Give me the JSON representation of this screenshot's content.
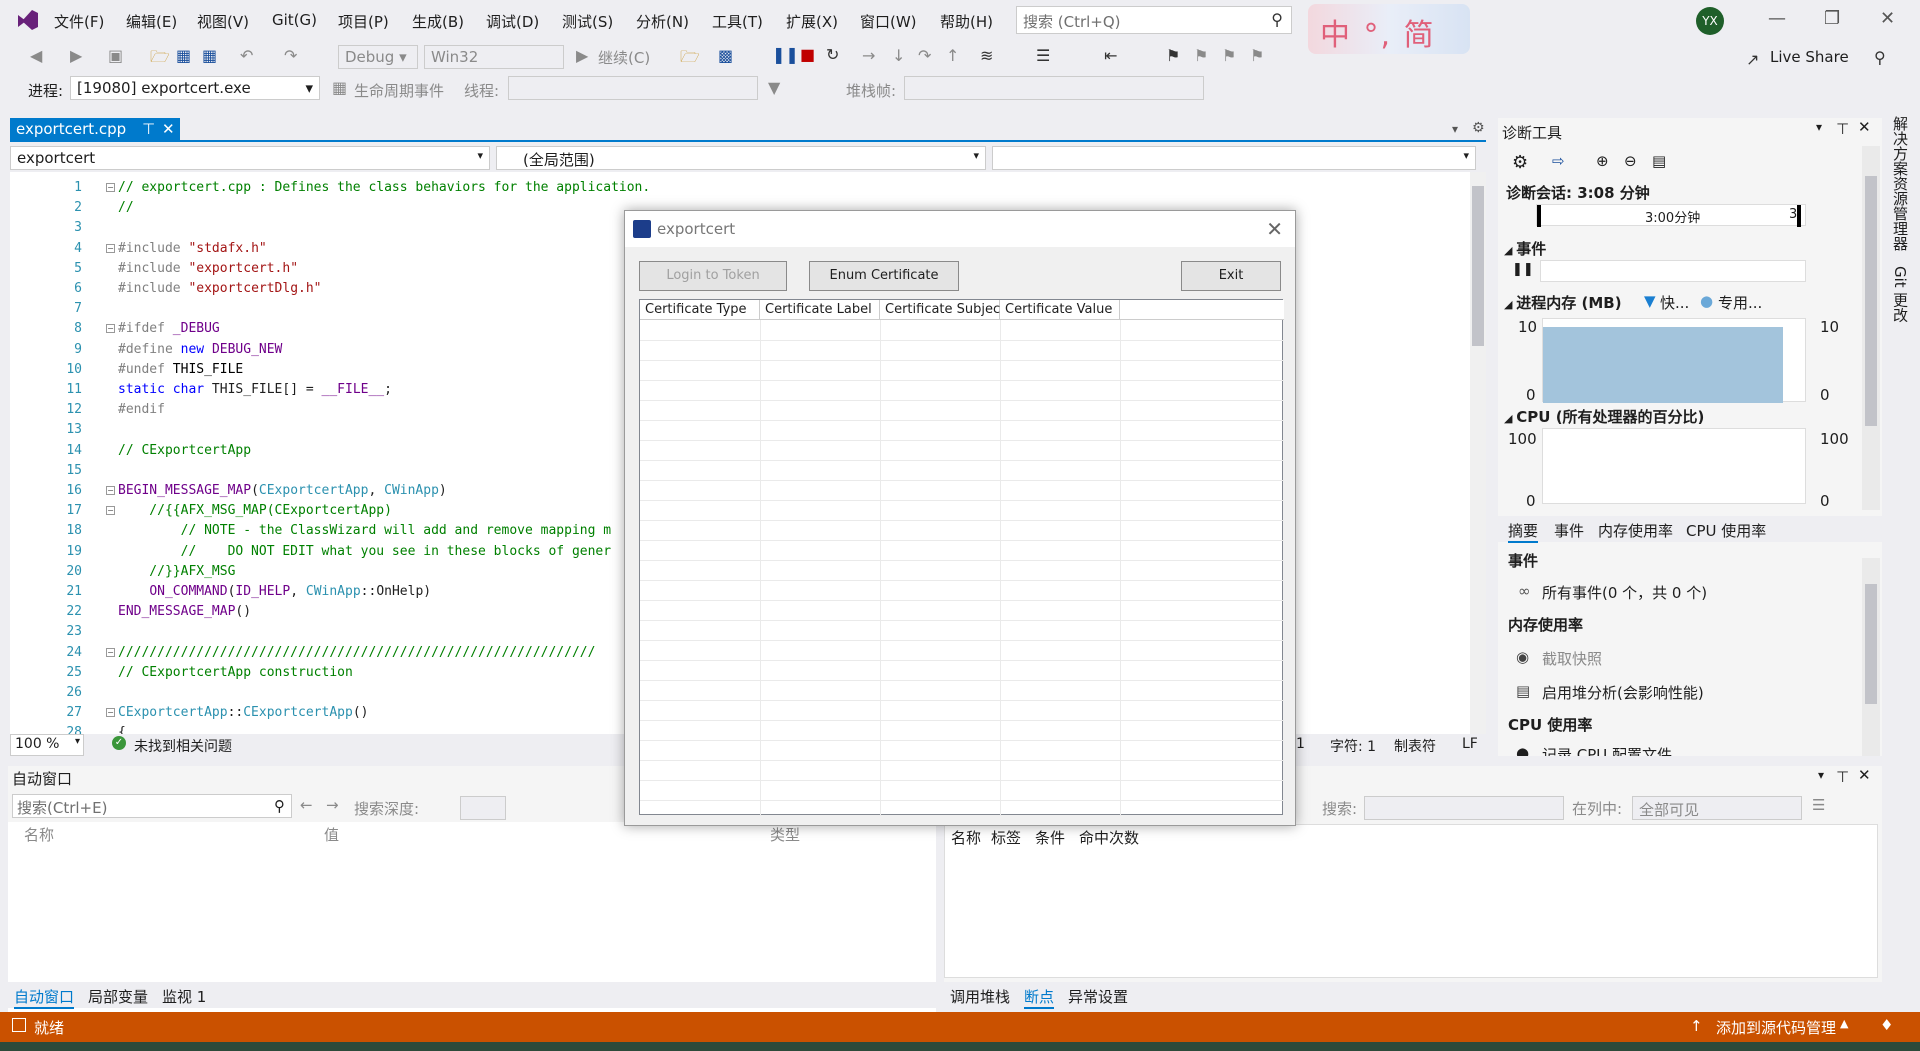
{
  "menu": [
    "文件(F)",
    "编辑(E)",
    "视图(V)",
    "Git(G)",
    "项目(P)",
    "生成(B)",
    "调试(D)",
    "测试(S)",
    "分析(N)",
    "工具(T)",
    "扩展(X)",
    "窗口(W)",
    "帮助(H)"
  ],
  "search": {
    "placeholder": "搜索 (Ctrl+Q)"
  },
  "ime": "中 °, 简",
  "avatar": "YX",
  "toolbar": {
    "config": "Debug",
    "platform": "Win32",
    "continue": "继续(C)",
    "live_share": "Live Share"
  },
  "toolbar2": {
    "process_label": "进程:",
    "process_value": "[19080] exportcert.exe",
    "lifecycle": "生命周期事件",
    "thread_label": "线程:",
    "stack_label": "堆栈帧:"
  },
  "editor": {
    "tab": "exportcert.cpp",
    "nav_left": "exportcert",
    "nav_mid": "(全局范围)",
    "zoom": "100 %",
    "issues": "未找到相关问题",
    "status_ln": "1",
    "status_ch": "字符: 1",
    "status_tab": "制表符",
    "status_lf": "LF",
    "line_numbers": [
      "1",
      "2",
      "3",
      "4",
      "5",
      "6",
      "7",
      "8",
      "9",
      "10",
      "11",
      "12",
      "13",
      "14",
      "15",
      "16",
      "17",
      "18",
      "19",
      "20",
      "21",
      "22",
      "23",
      "24",
      "25",
      "26",
      "27",
      "28"
    ]
  },
  "diag": {
    "title": "诊断工具",
    "session": "诊断会话: 3:08 分钟",
    "timeline": "3:00分钟",
    "timeline_end": "3",
    "events": "事件",
    "memory": "进程内存 (MB)",
    "mem_legend1": "快...",
    "mem_legend2": "专用...",
    "mem_max": "10",
    "mem_min": "0",
    "cpu": "CPU (所有处理器的百分比)",
    "cpu_max": "100",
    "cpu_min": "0",
    "tabs": [
      "摘要",
      "事件",
      "内存使用率",
      "CPU 使用率"
    ],
    "sec_events": "事件",
    "all_events": "所有事件(0 个，共 0 个)",
    "sec_mem": "内存使用率",
    "snapshot": "截取快照",
    "heap": "启用堆分析(会影响性能)",
    "sec_cpu": "CPU 使用率",
    "cpu_profile": "记录 CPU 配置文件"
  },
  "dialog": {
    "title": "exportcert",
    "btn_login": "Login to Token",
    "btn_enum": "Enum Certificate",
    "btn_exit": "Exit",
    "columns": [
      "Certificate Type",
      "Certificate Label",
      "Certificate Subject",
      "Certificate Value"
    ]
  },
  "autos": {
    "title": "自动窗口",
    "search": "搜索(Ctrl+E)",
    "depth": "搜索深度:",
    "cols": [
      "名称",
      "值",
      "类型"
    ],
    "tabs": [
      "自动窗口",
      "局部变量",
      "监视 1"
    ]
  },
  "bps": {
    "search": "搜索:",
    "in_col": "在列中:",
    "all_visible": "全部可见",
    "cols": [
      "名称",
      "标签",
      "条件",
      "命中次数"
    ],
    "tabs": [
      "调用堆栈",
      "断点",
      "异常设置"
    ]
  },
  "status": {
    "left": "就绪",
    "right": "添加到源代码管理"
  },
  "rightrail": {
    "a": "解决方案资源管理器",
    "b": "Git 更改"
  },
  "colors": {
    "accent": "#007acc",
    "status": "#ca5100"
  }
}
